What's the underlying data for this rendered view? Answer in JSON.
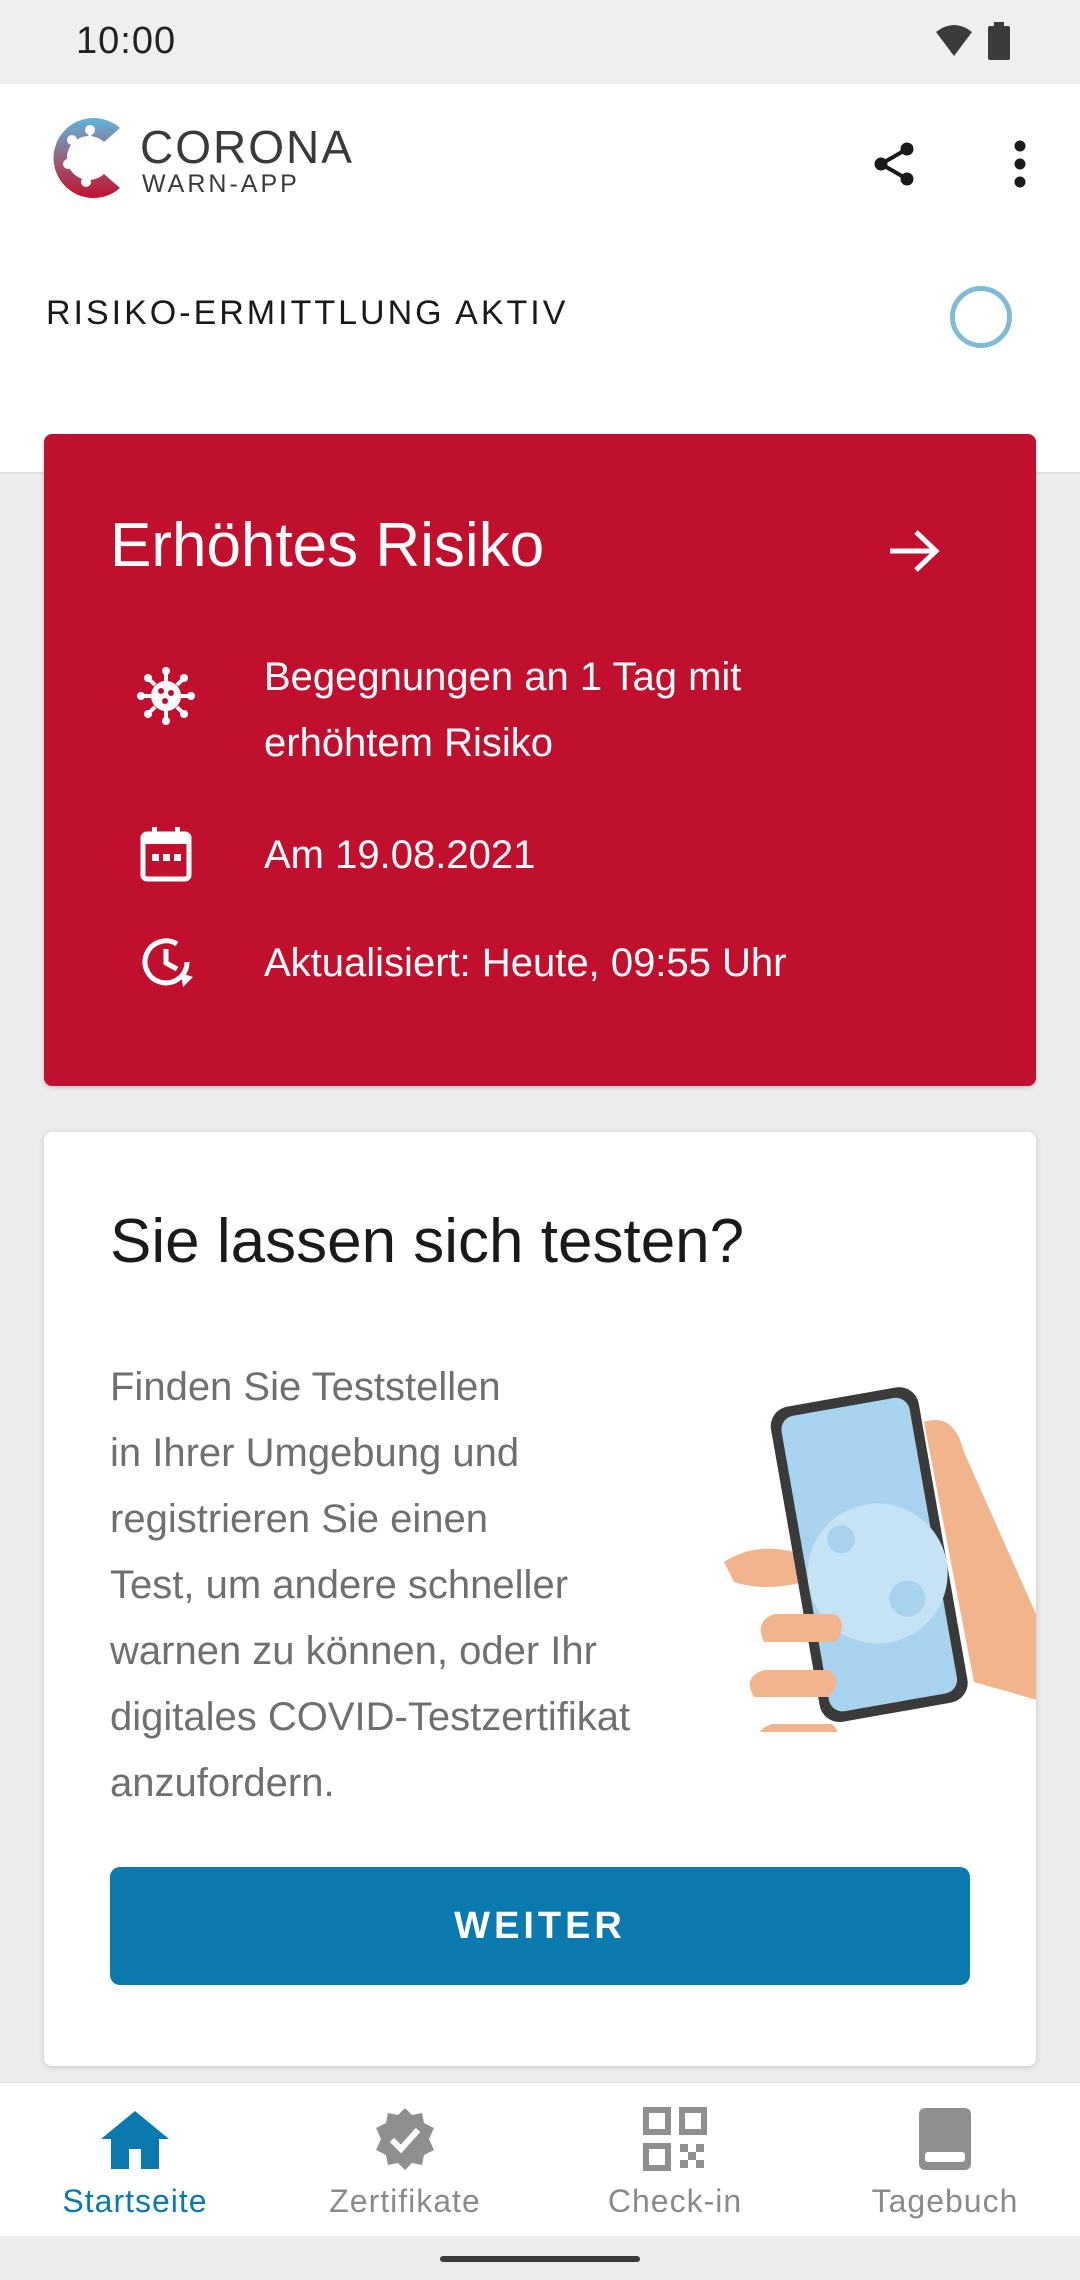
{
  "status_bar": {
    "time": "10:00"
  },
  "brand": {
    "name": "CORONA",
    "sub": "WARN-APP"
  },
  "tracing": {
    "label": "RISIKO-ERMITTLUNG AKTIV"
  },
  "risk_card": {
    "title": "Erhöhtes Risiko",
    "encounters_line1": "Begegnungen an 1 Tag mit",
    "encounters_line2": "erhöhtem Risiko",
    "date": "Am 19.08.2021",
    "updated": "Aktualisiert: Heute, 09:55 Uhr",
    "color": "#c0102e"
  },
  "test_card": {
    "title": "Sie lassen sich testen?",
    "body_lines": [
      "Finden Sie Teststellen",
      "in Ihrer Umgebung und",
      "registrieren Sie einen",
      "Test, um andere schneller",
      "warnen zu können, oder Ihr",
      "digitales COVID-Testzertifikat",
      "anzufordern."
    ],
    "button": "WEITER",
    "button_color": "#0a7aae"
  },
  "bottom_nav": {
    "items": [
      {
        "label": "Startseite",
        "icon": "home-icon",
        "active": true
      },
      {
        "label": "Zertifikate",
        "icon": "certificate-badge-icon",
        "active": false
      },
      {
        "label": "Check-in",
        "icon": "qr-code-icon",
        "active": false
      },
      {
        "label": "Tagebuch",
        "icon": "diary-book-icon",
        "active": false
      }
    ]
  }
}
